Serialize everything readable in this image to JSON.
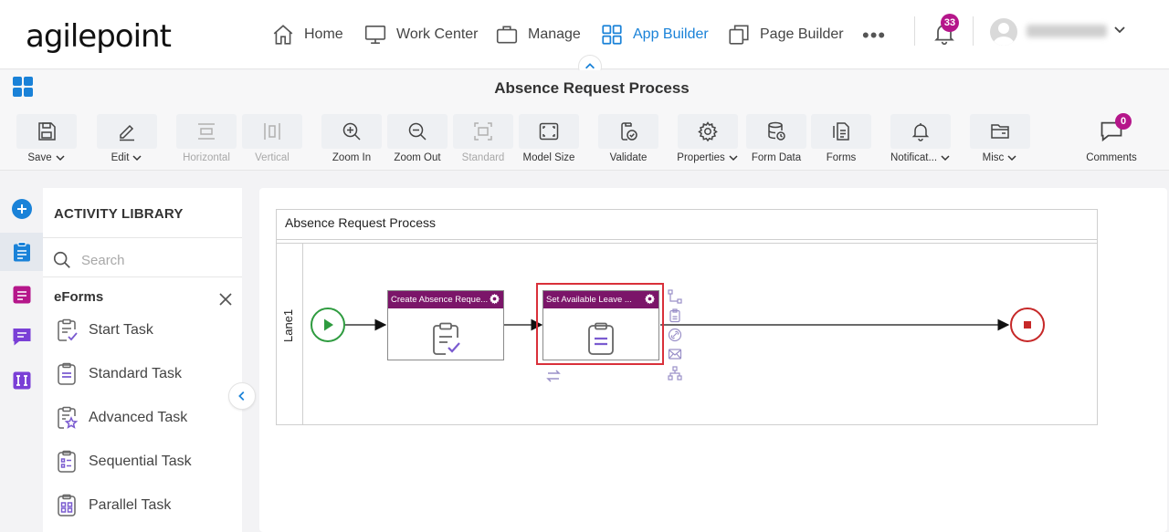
{
  "brand": {
    "logo_text": "agilepoint"
  },
  "nav": {
    "items": [
      {
        "label": "Home",
        "icon": "home-icon"
      },
      {
        "label": "Work Center",
        "icon": "monitor-icon"
      },
      {
        "label": "Manage",
        "icon": "briefcase-icon"
      },
      {
        "label": "App Builder",
        "icon": "grid-icon",
        "active": true
      },
      {
        "label": "Page Builder",
        "icon": "pages-icon"
      }
    ],
    "more": "•••",
    "notifications_count": "33"
  },
  "title": "Absence Request Process",
  "toolbar": {
    "save": "Save",
    "edit": "Edit",
    "horizontal": "Horizontal",
    "vertical": "Vertical",
    "zoom_in": "Zoom In",
    "zoom_out": "Zoom Out",
    "standard": "Standard",
    "model_size": "Model Size",
    "validate": "Validate",
    "properties": "Properties",
    "form_data": "Form Data",
    "forms": "Forms",
    "notifications": "Notificat...",
    "misc": "Misc",
    "comments": "Comments",
    "comments_count": "0"
  },
  "library": {
    "title": "ACTIVITY LIBRARY",
    "search_placeholder": "Search",
    "category": "eForms",
    "items": [
      {
        "label": "Start Task",
        "icon": "start-task-icon"
      },
      {
        "label": "Standard Task",
        "icon": "standard-task-icon"
      },
      {
        "label": "Advanced Task",
        "icon": "advanced-task-icon"
      },
      {
        "label": "Sequential Task",
        "icon": "sequential-task-icon"
      },
      {
        "label": "Parallel Task",
        "icon": "parallel-task-icon"
      }
    ]
  },
  "process": {
    "pool_title": "Absence Request Process",
    "lane": "Lane1",
    "nodes": [
      {
        "title": "Create Absence Reque..."
      },
      {
        "title": "Set Available Leave ..."
      }
    ]
  },
  "colors": {
    "accent": "#1a82d8",
    "node_header": "#7b1569",
    "badge": "#b5168a",
    "start": "#2e9b3f",
    "end": "#c62828",
    "selection": "#d9303a",
    "task_icon": "#7a5bd0"
  }
}
